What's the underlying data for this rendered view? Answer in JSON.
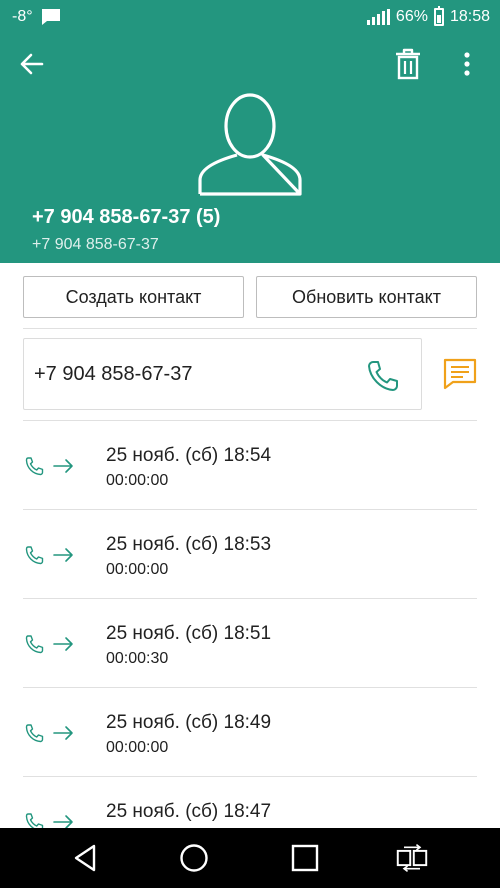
{
  "status_bar": {
    "temperature": "-8°",
    "battery": "66%",
    "time": "18:58"
  },
  "header": {
    "title": "+7 904 858-67-37 (5)",
    "subtitle": "+7 904 858-67-37"
  },
  "actions": {
    "create_contact": "Создать контакт",
    "update_contact": "Обновить контакт"
  },
  "number_card": {
    "number": "+7 904 858-67-37"
  },
  "calls": [
    {
      "date": "25 нояб. (сб) 18:54",
      "duration": "00:00:00"
    },
    {
      "date": "25 нояб. (сб) 18:53",
      "duration": "00:00:00"
    },
    {
      "date": "25 нояб. (сб) 18:51",
      "duration": "00:00:30"
    },
    {
      "date": "25 нояб. (сб) 18:49",
      "duration": "00:00:00"
    },
    {
      "date": "25 нояб. (сб) 18:47",
      "duration": ""
    }
  ],
  "colors": {
    "header": "#23967f",
    "accent": "#23967f",
    "message": "#f0a11a"
  },
  "icons": {
    "call_direction": "outgoing-call-icon",
    "nav": [
      "back-triangle-icon",
      "home-circle-icon",
      "recents-square-icon",
      "dual-window-icon"
    ]
  }
}
